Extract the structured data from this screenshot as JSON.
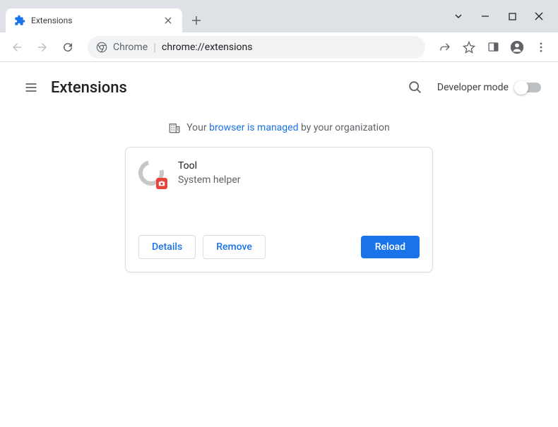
{
  "window": {
    "tab_title": "Extensions"
  },
  "omnibox": {
    "prefix": "Chrome",
    "url": "chrome://extensions"
  },
  "page": {
    "title": "Extensions",
    "developer_mode_label": "Developer mode"
  },
  "managed_banner": {
    "text_before": "Your ",
    "link_text": "browser is managed",
    "text_after": " by your organization"
  },
  "extension": {
    "name": "Tool",
    "description": "System helper",
    "details_label": "Details",
    "remove_label": "Remove",
    "reload_label": "Reload"
  }
}
